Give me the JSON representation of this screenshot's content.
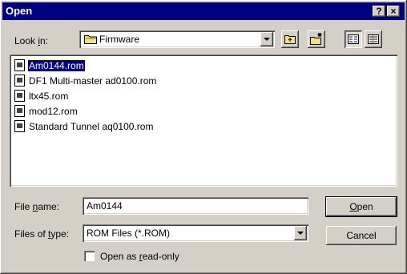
{
  "window": {
    "title": "Open",
    "help_button": "?",
    "close_button": "×"
  },
  "look_in": {
    "label_pre": "Look ",
    "label_accel": "i",
    "label_post": "n:",
    "value": "Firmware"
  },
  "toolbar": {
    "up_folder": "up-one-level",
    "new_folder": "create-new-folder",
    "list_view": "list",
    "details_view": "details"
  },
  "files": [
    {
      "name": "Am0144.rom",
      "selected": true
    },
    {
      "name": "DF1 Multi-master ad0100.rom",
      "selected": false
    },
    {
      "name": "ltx45.rom",
      "selected": false
    },
    {
      "name": "mod12.rom",
      "selected": false
    },
    {
      "name": "Standard Tunnel aq0100.rom",
      "selected": false
    }
  ],
  "file_name": {
    "label_pre": "File ",
    "label_accel": "n",
    "label_post": "ame:",
    "value": "Am0144"
  },
  "file_type": {
    "label_pre": "Files of ",
    "label_accel": "t",
    "label_post": "ype:",
    "value": "ROM Files (*.ROM)"
  },
  "buttons": {
    "open_accel": "O",
    "open_rest": "pen",
    "cancel": "Cancel"
  },
  "read_only": {
    "label_pre": "Open as ",
    "label_accel": "r",
    "label_post": "ead-only",
    "checked": false
  }
}
